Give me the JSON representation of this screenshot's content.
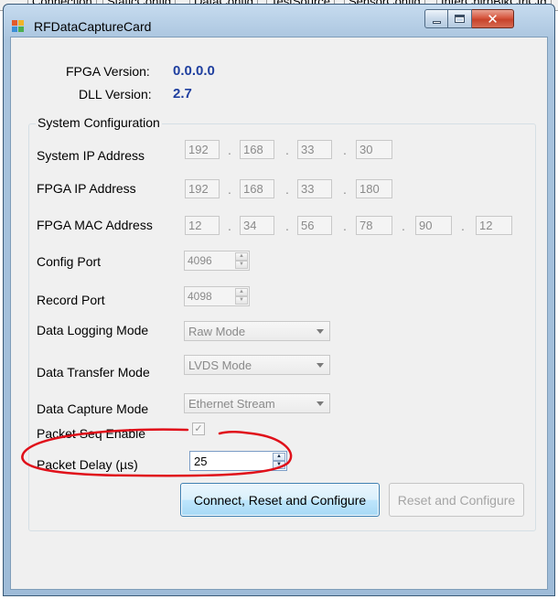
{
  "background_tabs": [
    "Connection",
    "StaticConfig",
    "DataConfig",
    "TestSource",
    "SensorConfig",
    "InterChirpBlkCtrlCfg"
  ],
  "window": {
    "title": "RFDataCaptureCard",
    "icon": "app-window-icon",
    "controls": {
      "minimize": "minimize-icon",
      "maximize": "maximize-icon",
      "close": "✕"
    }
  },
  "info": {
    "fpga_version_label": "FPGA Version:",
    "fpga_version_value": "0.0.0.0",
    "dll_version_label": "DLL Version:",
    "dll_version_value": "2.7"
  },
  "system_config": {
    "title": "System Configuration",
    "system_ip": {
      "label": "System IP Address",
      "octets": [
        "192",
        "168",
        "33",
        "30"
      ]
    },
    "fpga_ip": {
      "label": "FPGA IP Address",
      "octets": [
        "192",
        "168",
        "33",
        "180"
      ]
    },
    "fpga_mac": {
      "label": "FPGA MAC Address",
      "octets": [
        "12",
        "34",
        "56",
        "78",
        "90",
        "12"
      ]
    },
    "config_port": {
      "label": "Config Port",
      "value": "4096"
    },
    "record_port": {
      "label": "Record Port",
      "value": "4098"
    },
    "data_logging_mode": {
      "label": "Data Logging Mode",
      "value": "Raw Mode"
    },
    "data_transfer_mode": {
      "label": "Data Transfer Mode",
      "value": "LVDS Mode"
    },
    "data_capture_mode": {
      "label": "Data Capture Mode",
      "value": "Ethernet Stream"
    },
    "packet_seq_enable": {
      "label": "Packet Seq Enable",
      "checked": true,
      "mark": "✓"
    },
    "packet_delay": {
      "label": "Packet Delay (µs)",
      "value": "25"
    }
  },
  "buttons": {
    "connect": "Connect, Reset and Configure",
    "reset": "Reset and Configure"
  },
  "spinner_arrows": {
    "up": "▲",
    "down": "▼"
  },
  "colors": {
    "version_value": "#1f3f9f",
    "annotation": "#e0101a",
    "primary_button_border": "#3c7fb1",
    "close_button": "#c7432b"
  }
}
